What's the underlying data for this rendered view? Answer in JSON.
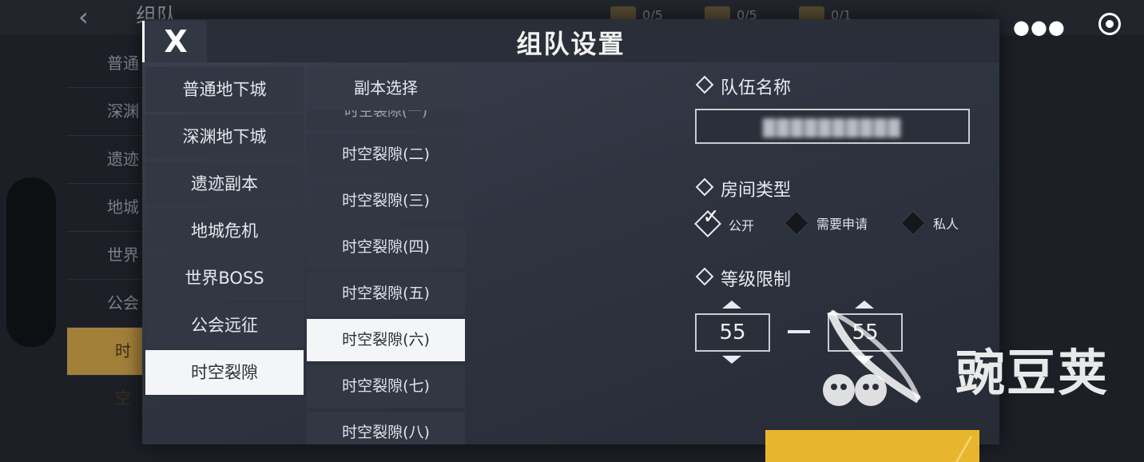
{
  "background": {
    "back_icon": "back-arrow-icon",
    "title": "组队",
    "resources": [
      "0/5",
      "0/5",
      "0/1"
    ],
    "sidebar_items": [
      "普通",
      "深渊",
      "遗迹",
      "地城",
      "世界",
      "公会",
      "时空"
    ]
  },
  "modal": {
    "title": "组队设置",
    "close_label": "X",
    "categories": [
      {
        "label": "普通地下城",
        "active": false
      },
      {
        "label": "深渊地下城",
        "active": false
      },
      {
        "label": "遗迹副本",
        "active": false
      },
      {
        "label": "地城危机",
        "active": false
      },
      {
        "label": "世界BOSS",
        "active": false
      },
      {
        "label": "公会远征",
        "active": false
      },
      {
        "label": "时空裂隙",
        "active": true
      }
    ],
    "sub_header": "副本选择",
    "sub_partial": "时空裂隙(一)",
    "sub_items": [
      {
        "label": "时空裂隙(二)",
        "active": false
      },
      {
        "label": "时空裂隙(三)",
        "active": false
      },
      {
        "label": "时空裂隙(四)",
        "active": false
      },
      {
        "label": "时空裂隙(五)",
        "active": false
      },
      {
        "label": "时空裂隙(六)",
        "active": true
      },
      {
        "label": "时空裂隙(七)",
        "active": false
      },
      {
        "label": "时空裂隙(八)",
        "active": false
      }
    ],
    "settings": {
      "team_name_label": "队伍名称",
      "team_name_value": "██████████",
      "room_type_label": "房间类型",
      "room_options": [
        {
          "label": "公开",
          "checked": true
        },
        {
          "label": "需要申请",
          "checked": false
        },
        {
          "label": "私人",
          "checked": false
        }
      ],
      "level_label": "等级限制",
      "level_min": "55",
      "level_max": "55"
    }
  },
  "watermark": {
    "text": "豌豆荚"
  },
  "colors": {
    "accent_gold": "#e8b62c",
    "active_bg": "#f4f5f7",
    "panel": "#323744"
  }
}
